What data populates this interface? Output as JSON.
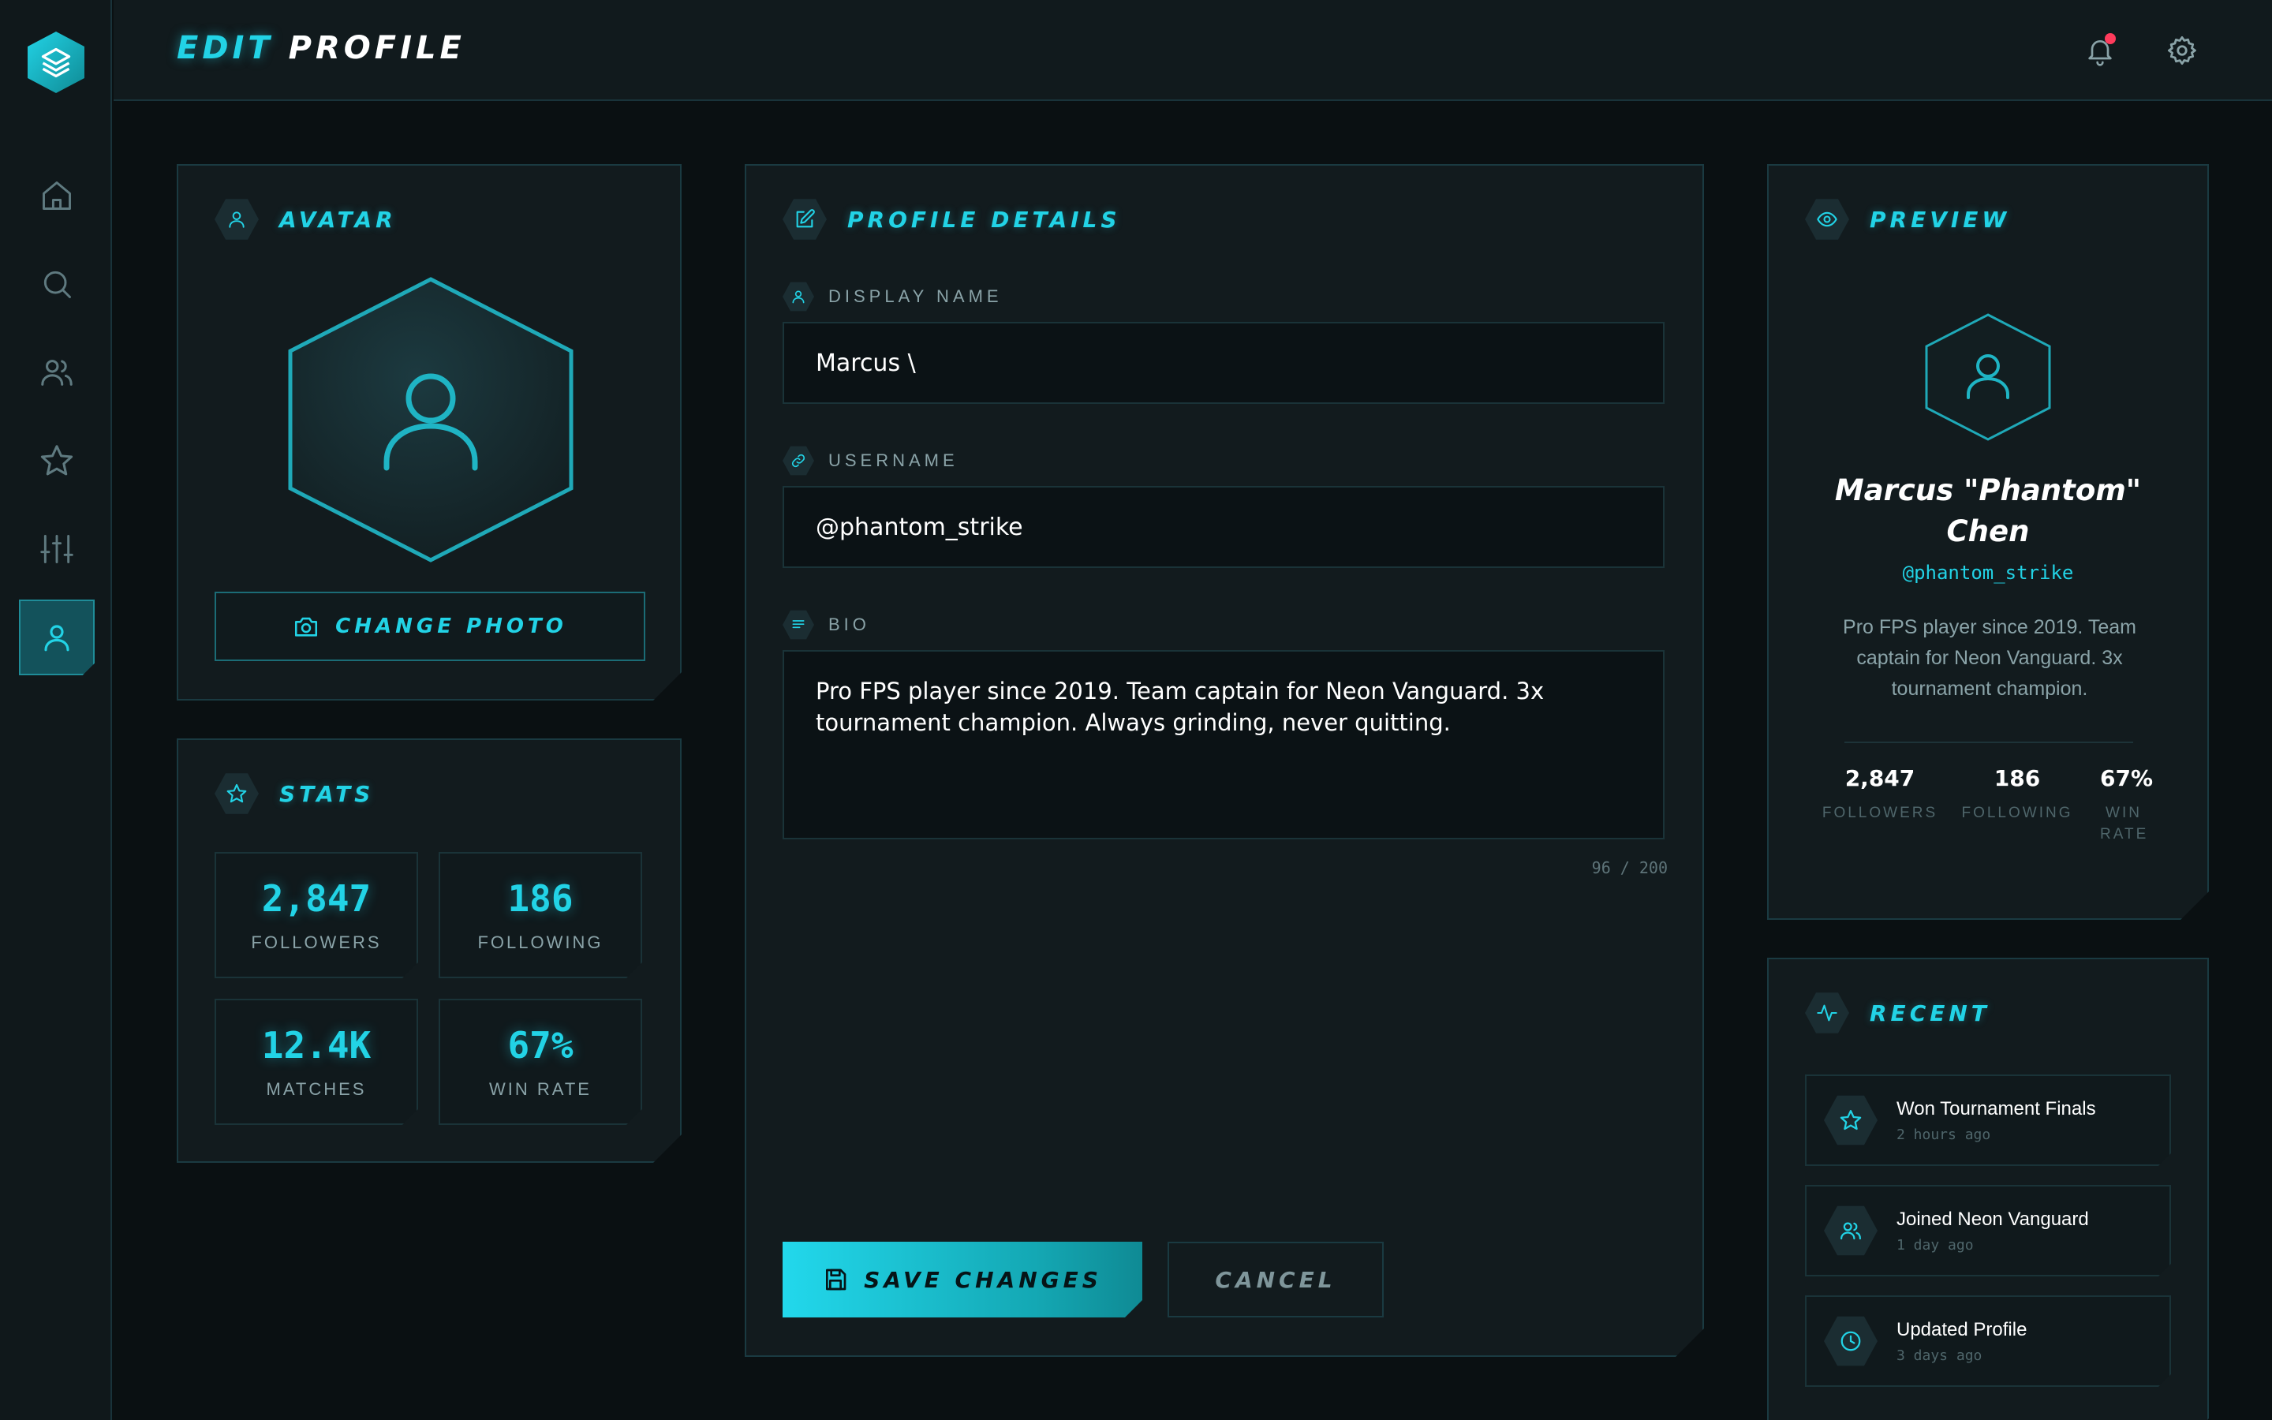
{
  "header": {
    "title_accent": "EDIT",
    "title_rest": "PROFILE",
    "has_notification": true
  },
  "sidebar": {
    "items": [
      {
        "icon": "home-icon"
      },
      {
        "icon": "search-icon"
      },
      {
        "icon": "users-icon"
      },
      {
        "icon": "star-icon"
      },
      {
        "icon": "sliders-icon"
      },
      {
        "icon": "user-icon",
        "active": true
      }
    ]
  },
  "avatar": {
    "title": "AVATAR",
    "change_photo_label": "CHANGE PHOTO"
  },
  "stats": {
    "title": "STATS",
    "items": [
      {
        "value": "2,847",
        "label": "FOLLOWERS"
      },
      {
        "value": "186",
        "label": "FOLLOWING"
      },
      {
        "value": "12.4K",
        "label": "MATCHES"
      },
      {
        "value": "67%",
        "label": "WIN RATE"
      }
    ]
  },
  "profile": {
    "title": "PROFILE DETAILS",
    "display_name": {
      "label": "DISPLAY NAME",
      "value": "Marcus \\"
    },
    "username": {
      "label": "USERNAME",
      "value": "@phantom_strike"
    },
    "bio": {
      "label": "BIO",
      "value": "Pro FPS player since 2019. Team captain for Neon Vanguard. 3x tournament champion. Always grinding, never quitting."
    },
    "char_count": "96 / 200",
    "save_label": "SAVE CHANGES",
    "cancel_label": "CANCEL"
  },
  "preview": {
    "title": "PREVIEW",
    "name": "Marcus \"Phantom\" Chen",
    "username": "@phantom_strike",
    "bio": "Pro FPS player since 2019. Team captain for Neon Vanguard. 3x tournament champion.",
    "stats": [
      {
        "value": "2,847",
        "label": "FOLLOWERS"
      },
      {
        "value": "186",
        "label": "FOLLOWING"
      },
      {
        "value": "67%",
        "label": "WIN RATE"
      }
    ]
  },
  "recent": {
    "title": "RECENT",
    "items": [
      {
        "title": "Won Tournament Finals",
        "time": "2 hours ago",
        "icon": "star-icon"
      },
      {
        "title": "Joined Neon Vanguard",
        "time": "1 day ago",
        "icon": "users-icon"
      },
      {
        "title": "Updated Profile",
        "time": "3 days ago",
        "icon": "clock-icon"
      }
    ]
  },
  "colors": {
    "accent": "#22d3e6",
    "background": "#0a1012",
    "panel": "#121b1e",
    "notification": "#ff3b5c"
  }
}
